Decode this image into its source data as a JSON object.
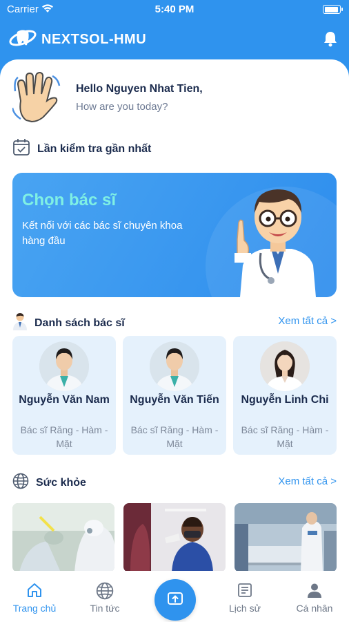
{
  "status": {
    "carrier": "Carrier",
    "time": "5:40 PM"
  },
  "header": {
    "title": "NEXTSOL-HMU"
  },
  "greeting": {
    "hello": "Hello Nguyen Nhat Tien,",
    "sub": "How are you today?"
  },
  "last_check": {
    "label": "Lần kiểm tra gần nhất"
  },
  "banner": {
    "title": "Chọn bác sĩ",
    "desc": "Kết nối với các bác sĩ chuyên khoa hàng đầu"
  },
  "doctors": {
    "label": "Danh sách bác sĩ",
    "see_all": "Xem tất cả >",
    "items": [
      {
        "name": "Nguyễn Văn Nam",
        "specialty": "Bác sĩ Răng - Hàm - Mặt"
      },
      {
        "name": "Nguyễn Văn Tiến",
        "specialty": "Bác sĩ Răng - Hàm - Mặt"
      },
      {
        "name": "Nguyễn Linh Chi",
        "specialty": "Bác sĩ Răng - Hàm - Mặt"
      }
    ]
  },
  "health": {
    "label": "Sức khỏe",
    "see_all": "Xem tất cả >"
  },
  "tabs": [
    {
      "label": "Trang chủ",
      "icon": "home-icon"
    },
    {
      "label": "Tin tức",
      "icon": "globe-icon"
    },
    {
      "label": "",
      "icon": "upload-icon"
    },
    {
      "label": "Lịch sử",
      "icon": "history-icon"
    },
    {
      "label": "Cá nhân",
      "icon": "person-icon"
    }
  ],
  "colors": {
    "primary": "#2f93ee",
    "banner_title": "#7ff0e4",
    "text_dark": "#1b2b4d"
  }
}
